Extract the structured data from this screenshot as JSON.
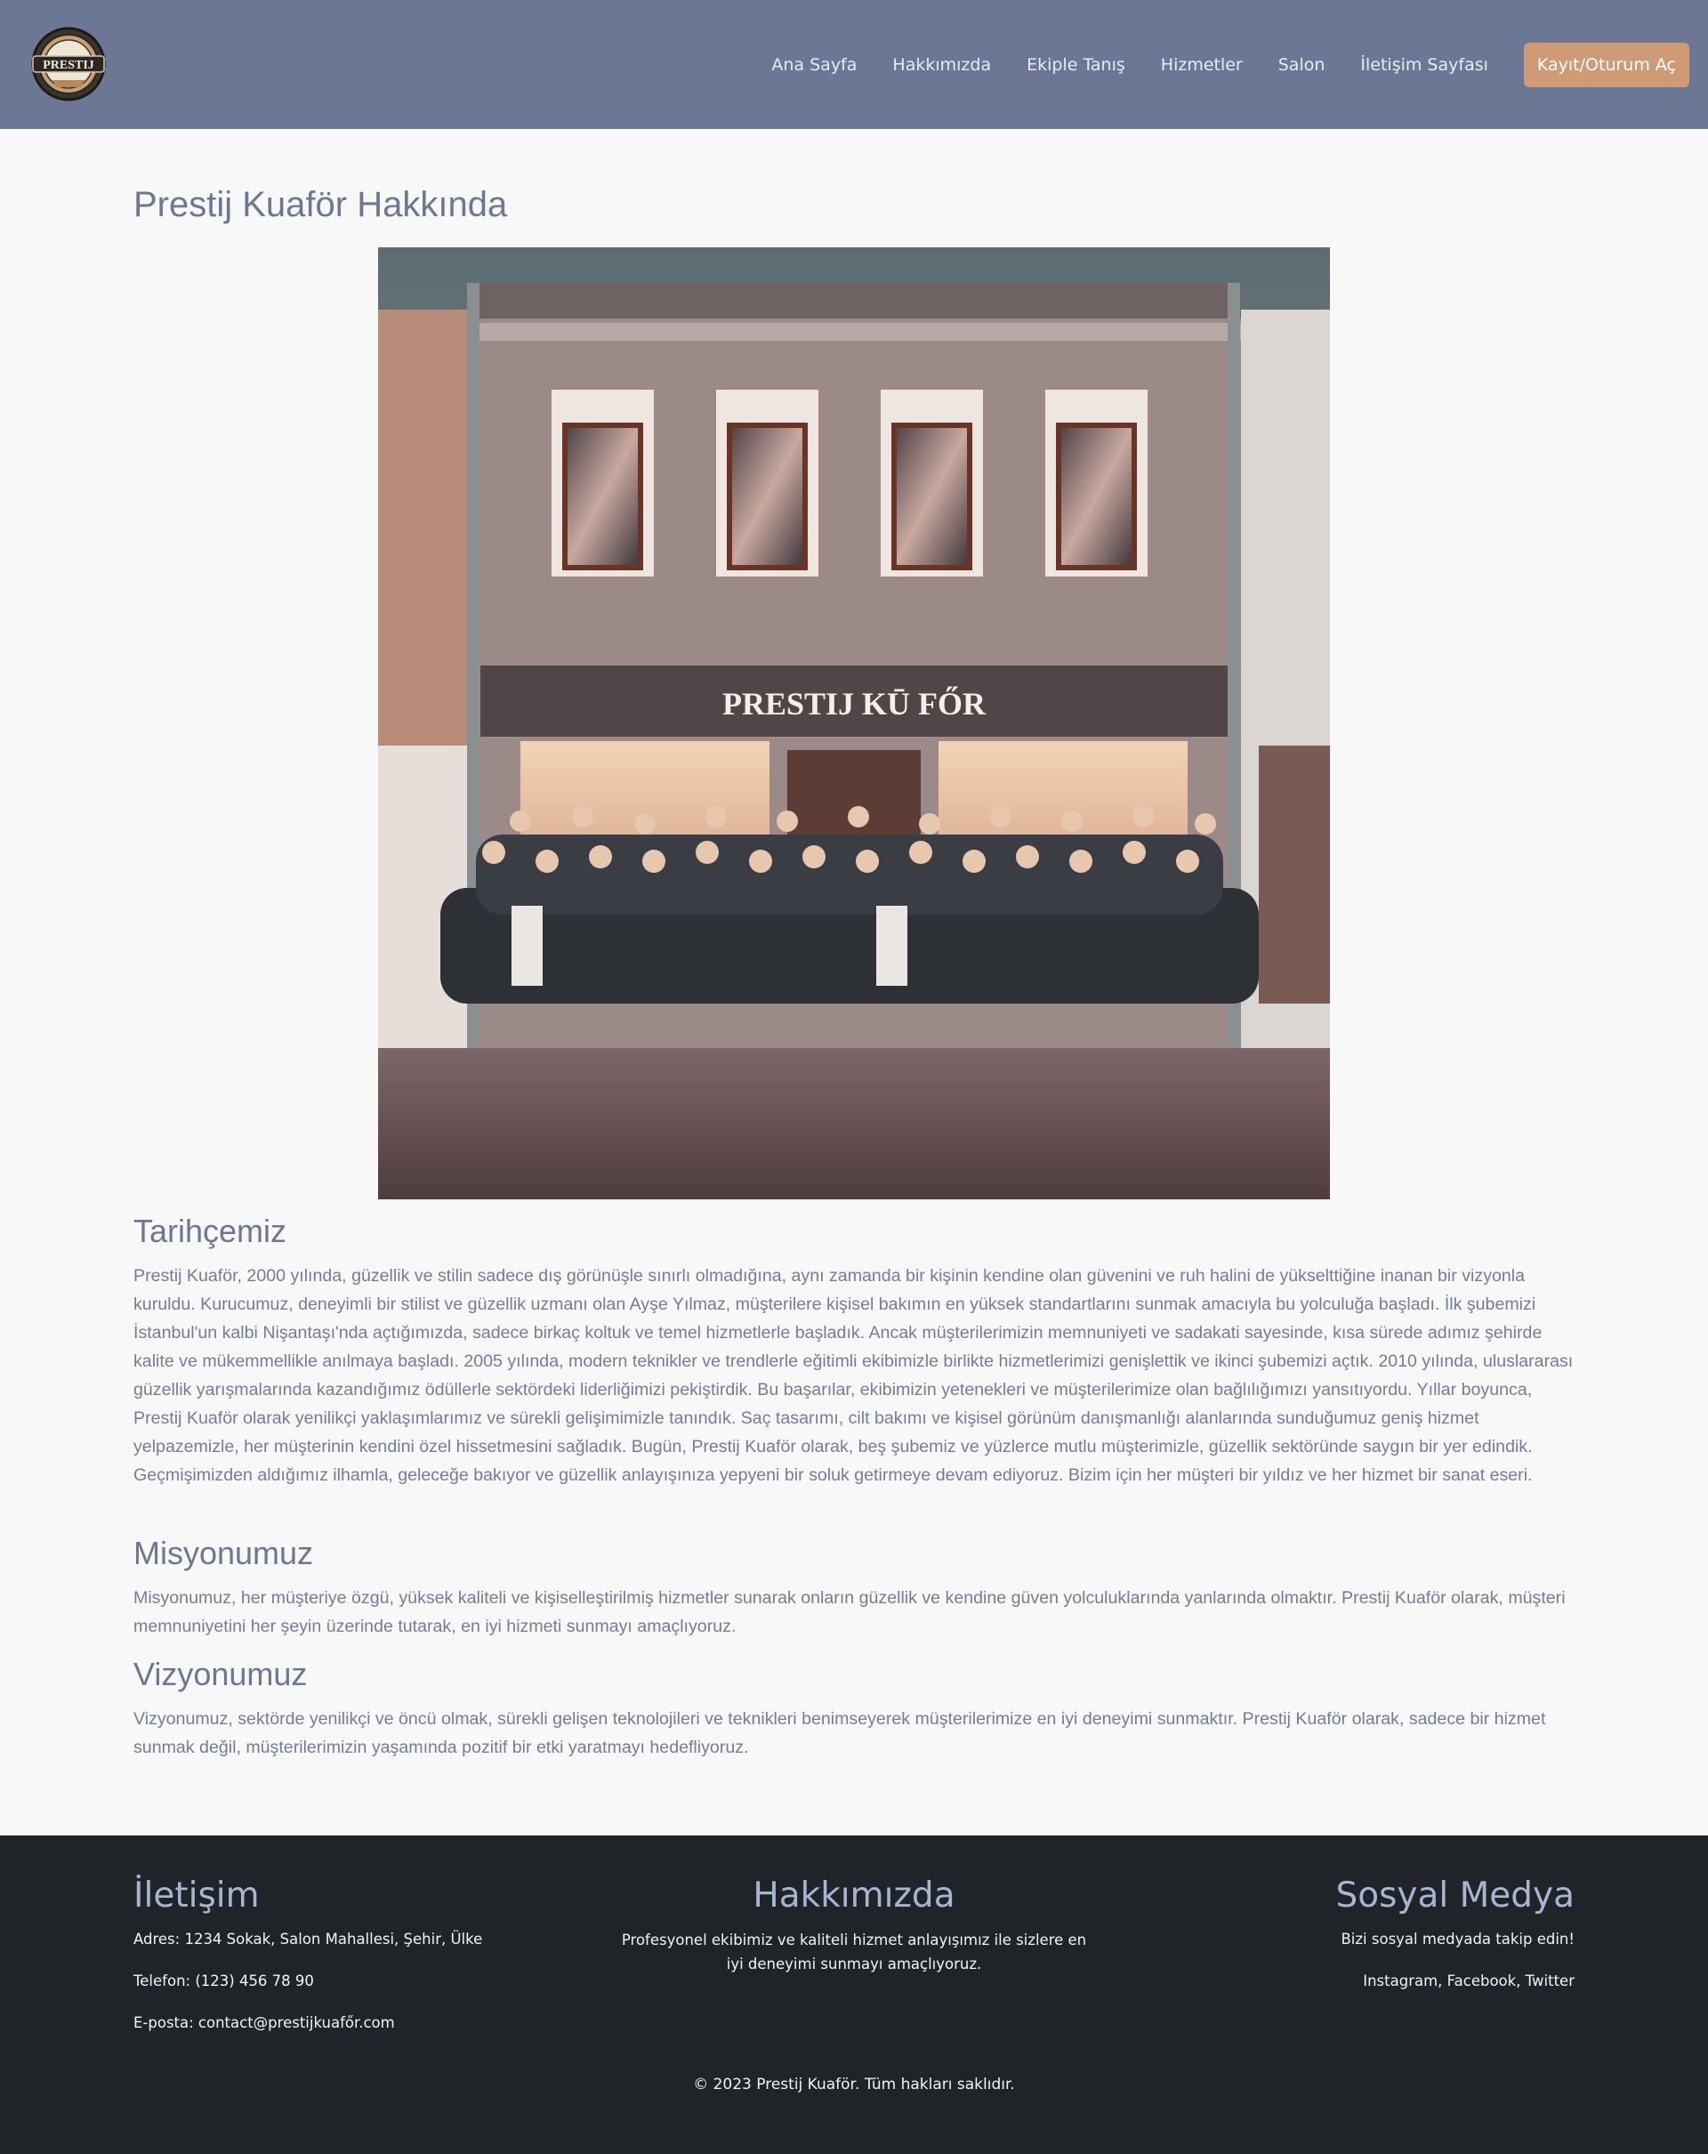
{
  "header": {
    "logo_text": "PRESTIJ",
    "nav": [
      "Ana Sayfa",
      "Hakkımızda",
      "Ekiple Tanış",
      "Hizmetler",
      "Salon",
      "İletişim Sayfası"
    ],
    "cta_label": "Kayıt/Oturum Aç"
  },
  "main": {
    "title": "Prestij Kuaför Hakkında",
    "hero_sign": "PRESTIJ KŪ FŐR",
    "history": {
      "title": "Tarihçemiz",
      "text": "Prestij Kuaför, 2000 yılında, güzellik ve stilin sadece dış görünüşle sınırlı olmadığına, aynı zamanda bir kişinin kendine olan güvenini ve ruh halini de yükselttiğine inanan bir vizyonla kuruldu. Kurucumuz, deneyimli bir stilist ve güzellik uzmanı olan Ayşe Yılmaz, müşterilere kişisel bakımın en yüksek standartlarını sunmak amacıyla bu yolculuğa başladı. İlk şubemizi İstanbul'un kalbi Nişantaşı'nda açtığımızda, sadece birkaç koltuk ve temel hizmetlerle başladık. Ancak müşterilerimizin memnuniyeti ve sadakati sayesinde, kısa sürede adımız şehirde kalite ve mükemmellikle anılmaya başladı. 2005 yılında, modern teknikler ve trendlerle eğitimli ekibimizle birlikte hizmetlerimizi genişlettik ve ikinci şubemizi açtık. 2010 yılında, uluslararası güzellik yarışmalarında kazandığımız ödüllerle sektördeki liderliğimizi pekiştirdik. Bu başarılar, ekibimizin yetenekleri ve müşterilerimize olan bağlılığımızı yansıtıyordu. Yıllar boyunca, Prestij Kuaför olarak yenilikçi yaklaşımlarımız ve sürekli gelişimimizle tanındık. Saç tasarımı, cilt bakımı ve kişisel görünüm danışmanlığı alanlarında sunduğumuz geniş hizmet yelpazemizle, her müşterinin kendini özel hissetmesini sağladık. Bugün, Prestij Kuaför olarak, beş şubemiz ve yüzlerce mutlu müşterimizle, güzellik sektöründe saygın bir yer edindik. Geçmişimizden aldığımız ilhamla, geleceğe bakıyor ve güzellik anlayışınıza yepyeni bir soluk getirmeye devam ediyoruz. Bizim için her müşteri bir yıldız ve her hizmet bir sanat eseri."
    },
    "mission": {
      "title": "Misyonumuz",
      "text": "Misyonumuz, her müşteriye özgü, yüksek kaliteli ve kişiselleştirilmiş hizmetler sunarak onların güzellik ve kendine güven yolculuklarında yanlarında olmaktır. Prestij Kuaför olarak, müşteri memnuniyetini her şeyin üzerinde tutarak, en iyi hizmeti sunmayı amaçlıyoruz."
    },
    "vision": {
      "title": "Vizyonumuz",
      "text": "Vizyonumuz, sektörde yenilikçi ve öncü olmak, sürekli gelişen teknolojileri ve teknikleri benimseyerek müşterilerimize en iyi deneyimi sunmaktır. Prestij Kuaför olarak, sadece bir hizmet sunmak değil, müşterilerimizin yaşamında pozitif bir etki yaratmayı hedefliyoruz."
    }
  },
  "footer": {
    "contact": {
      "title": "İletişim",
      "address": "Adres: 1234 Sokak, Salon Mahallesi, Şehir, Ülke",
      "phone": "Telefon: (123) 456 78 90",
      "email": "E-posta: contact@prestijkuafőr.com"
    },
    "about": {
      "title": "Hakkımızda",
      "text": "Profesyonel ekibimiz ve kaliteli hizmet anlayışımız ile sizlere en iyi deneyimi sunmayı amaçlıyoruz."
    },
    "social": {
      "title": "Sosyal Medya",
      "text": "Bizi sosyal medyada takip edin!",
      "links": "Instagram, Facebook, Twitter"
    },
    "copyright": "© 2023 Prestij Kuaför. Tüm hakları saklıdır."
  },
  "colors": {
    "header_bg": "#6b7794",
    "cta_bg": "#cf9a76",
    "footer_bg": "#202327",
    "footer_heading": "#a8b5d2",
    "text": "#737d98"
  }
}
